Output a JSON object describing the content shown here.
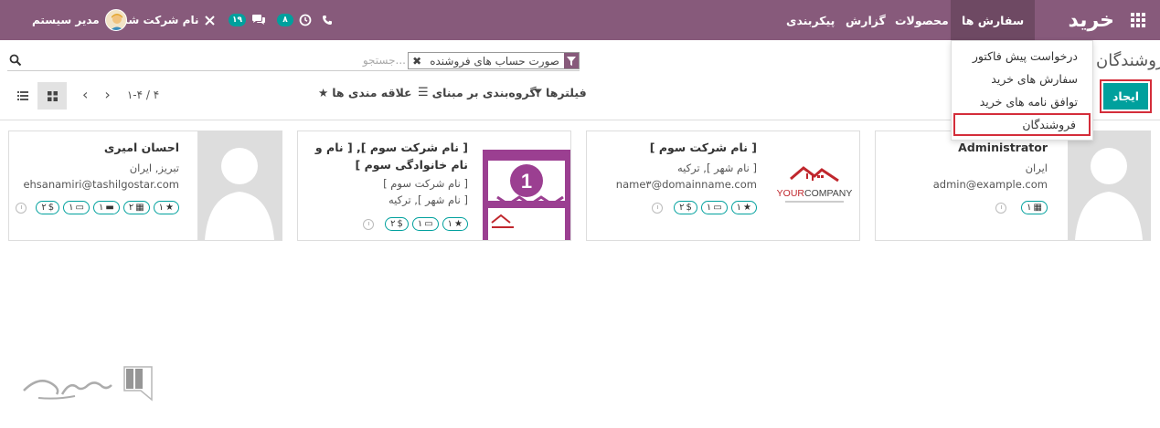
{
  "navbar": {
    "brand": "خرید",
    "menus": [
      "سفارش ها",
      "محصولات",
      "گزارش",
      "پیکربندی"
    ],
    "company": "نام شرکت شما",
    "user": "مدیر سیستم",
    "activity_badge": "۸",
    "message_badge": "۱۹"
  },
  "dropdown": {
    "items": [
      "درخواست پیش فاکتور",
      "سفارش های خرید",
      "توافق نامه های خرید",
      "فروشندگان"
    ]
  },
  "control_panel": {
    "title": "فروشندگان",
    "create_label": "ایجاد",
    "search_facet": "صورت حساب های فروشنده",
    "search_placeholder": "جستجو...",
    "filters_label": "فیلترها",
    "groupby_label": "گروه‌بندی بر مبنای",
    "favorites_label": "علاقه مندی ها",
    "pager": "۱-۴ / ۴"
  },
  "cards": [
    {
      "name": "Administrator",
      "lines": [
        "ایران",
        "admin@example.com"
      ],
      "tags": [
        [
          "calendar-icon",
          "۱"
        ]
      ]
    },
    {
      "name": "[ نام شرکت سوم ]",
      "lines": [
        "[ نام شهر ], ترکیه",
        "name۳@domainname.com"
      ],
      "tags": [
        [
          "star-icon",
          "۱"
        ],
        [
          "clipboard-icon",
          "۱"
        ],
        [
          "dollar-icon",
          "۲"
        ]
      ],
      "logo_text": "YOURCOMPANY"
    },
    {
      "name": "[ نام شرکت سوم ], [ نام و نام خانوادگی سوم ]",
      "lines": [
        "[ نام شرکت سوم ]",
        "[ نام شهر ], ترکیه"
      ],
      "tags": [
        [
          "star-icon",
          "۱"
        ],
        [
          "clipboard-icon",
          "۱"
        ],
        [
          "dollar-icon",
          "۲"
        ]
      ]
    },
    {
      "name": "احسان امیری",
      "lines": [
        "تبریز, ایران",
        "ehsanamiri@tashilgostar.com"
      ],
      "tags": [
        [
          "star-icon",
          "۱"
        ],
        [
          "calendar-icon",
          "۲"
        ],
        [
          "briefcase-icon",
          "۱"
        ],
        [
          "clipboard-icon",
          "۱"
        ],
        [
          "dollar-icon",
          "۲"
        ]
      ]
    }
  ],
  "colors": {
    "navbar": "#875a7b",
    "accent": "#00a09d",
    "highlight": "#d42d3a"
  }
}
